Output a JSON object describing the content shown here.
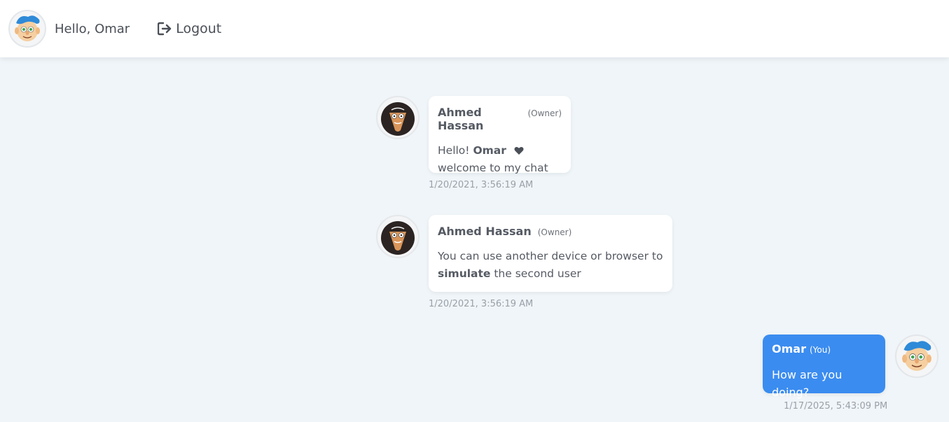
{
  "header": {
    "greeting": "Hello, Omar",
    "logout_label": "Logout",
    "logout_icon": "sign-out-icon"
  },
  "messages": [
    {
      "sender": "Ahmed Hassan",
      "role": "(Owner)",
      "text_parts": [
        "Hello! ",
        "Omar",
        " ",
        "welcome to my chat"
      ],
      "timestamp": "1/20/2021, 3:56:19 AM",
      "avatar": "owner-avatar-icon"
    },
    {
      "sender": "Ahmed Hassan",
      "role": "(Owner)",
      "text_parts": [
        "You can use another device or browser to",
        "simulate",
        " the second user"
      ],
      "timestamp": "1/20/2021, 3:56:19 AM",
      "avatar": "owner-avatar-icon"
    },
    {
      "sender": "Omar",
      "role": "(You)",
      "text": "How are you doing?",
      "timestamp": "1/17/2025, 5:43:09 PM",
      "avatar": "user-avatar-icon"
    }
  ],
  "colors": {
    "background": "#eff5f8",
    "own_bubble": "#3b8cf0",
    "text": "#555a63"
  }
}
